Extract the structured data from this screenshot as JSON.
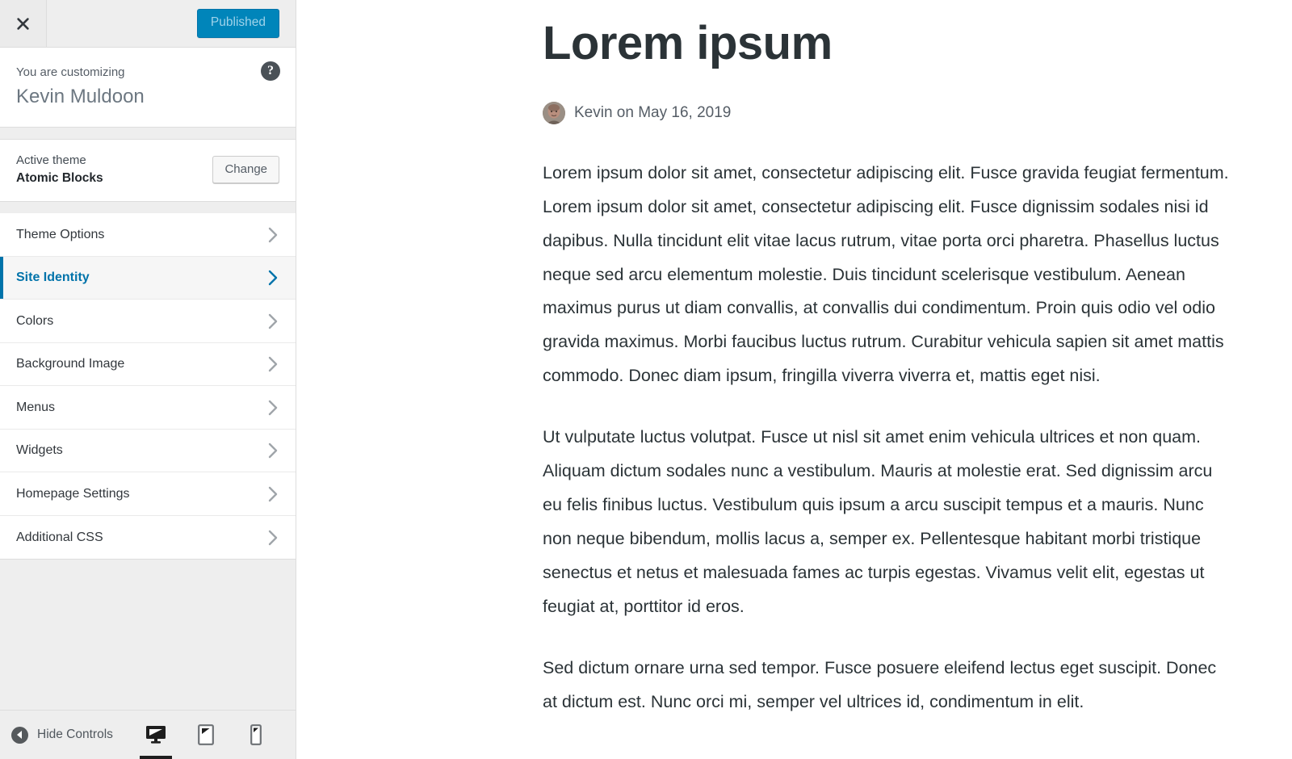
{
  "customizer": {
    "close_icon": "close-x-icon",
    "publish_button": "Published",
    "help_icon": "?",
    "preamble": "You are customizing",
    "site_name": "Kevin Muldoon",
    "theme": {
      "label": "Active theme",
      "name": "Atomic Blocks",
      "change_button": "Change"
    },
    "nav_items": [
      {
        "label": "Theme Options",
        "active": false
      },
      {
        "label": "Site Identity",
        "active": true
      },
      {
        "label": "Colors",
        "active": false
      },
      {
        "label": "Background Image",
        "active": false
      },
      {
        "label": "Menus",
        "active": false
      },
      {
        "label": "Widgets",
        "active": false
      },
      {
        "label": "Homepage Settings",
        "active": false
      },
      {
        "label": "Additional CSS",
        "active": false
      }
    ],
    "footer": {
      "hide_controls_label": "Hide Controls",
      "collapse_icon": "chevron-left-circle-icon",
      "devices": [
        {
          "name": "desktop",
          "icon": "desktop-icon",
          "active": true
        },
        {
          "name": "tablet",
          "icon": "tablet-icon",
          "active": false
        },
        {
          "name": "mobile",
          "icon": "mobile-icon",
          "active": false
        }
      ]
    },
    "colors": {
      "accent": "#0073aa",
      "publish_bg": "#0085ba",
      "panel_bg": "#eeeeee",
      "border": "#dddddd"
    }
  },
  "preview": {
    "post_title": "Lorem ipsum",
    "byline": "Kevin on May 16, 2019",
    "avatar_alt": "author-avatar",
    "paragraphs": [
      "Lorem ipsum dolor sit amet, consectetur adipiscing elit. Fusce gravida feugiat fermentum. Lorem ipsum dolor sit amet, consectetur adipiscing elit. Fusce dignissim sodales nisi id dapibus. Nulla tincidunt elit vitae lacus rutrum, vitae porta orci pharetra. Phasellus luctus neque sed arcu elementum molestie. Duis tincidunt scelerisque vestibulum. Aenean maximus purus ut diam convallis, at convallis dui condimentum. Proin quis odio vel odio gravida maximus. Morbi faucibus luctus rutrum. Curabitur vehicula sapien sit amet mattis commodo. Donec diam ipsum, fringilla viverra viverra et, mattis eget nisi.",
      "Ut vulputate luctus volutpat. Fusce ut nisl sit amet enim vehicula ultrices et non quam. Aliquam dictum sodales nunc a vestibulum. Mauris at molestie erat. Sed dignissim arcu eu felis finibus luctus. Vestibulum quis ipsum a arcu suscipit tempus et a mauris. Nunc non neque bibendum, mollis lacus a, semper ex. Pellentesque habitant morbi tristique senectus et netus et malesuada fames ac turpis egestas. Vivamus velit elit, egestas ut feugiat at, porttitor id eros.",
      "Sed dictum ornare urna sed tempor. Fusce posuere eleifend lectus eget suscipit. Donec at dictum est. Nunc orci mi, semper vel ultrices id, condimentum in elit."
    ]
  }
}
